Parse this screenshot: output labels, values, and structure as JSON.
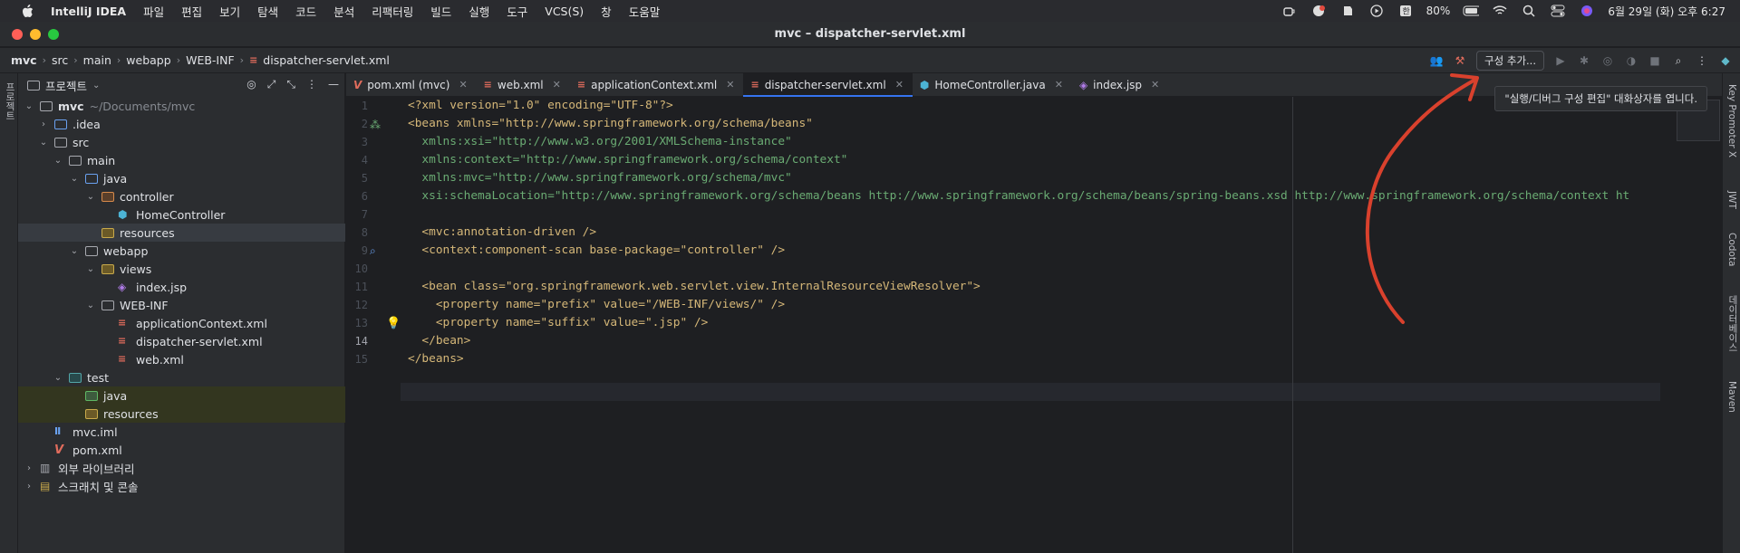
{
  "menubar": {
    "app": "IntelliJ IDEA",
    "items": [
      "파일",
      "편집",
      "보기",
      "탐색",
      "코드",
      "분석",
      "리팩터링",
      "빌드",
      "실행",
      "도구",
      "VCS(S)",
      "창",
      "도움말"
    ],
    "battery": "80%",
    "datetime": "6월 29일 (화) 오후 6:27"
  },
  "window": {
    "title": "mvc – dispatcher-servlet.xml"
  },
  "breadcrumbs": [
    "mvc",
    "src",
    "main",
    "webapp",
    "WEB-INF",
    "dispatcher-servlet.xml"
  ],
  "toolbar": {
    "run_config": "구성 추가..."
  },
  "tooltip": "\"실행/디버그 구성 편집\" 대화상자를 엽니다.",
  "project": {
    "title": "프로젝트",
    "root_label": "mvc",
    "root_path": "~/Documents/mvc",
    "tree": [
      {
        "label": ".idea"
      },
      {
        "label": "src"
      },
      {
        "label": "main"
      },
      {
        "label": "java"
      },
      {
        "label": "controller"
      },
      {
        "label": "HomeController"
      },
      {
        "label": "resources"
      },
      {
        "label": "webapp"
      },
      {
        "label": "views"
      },
      {
        "label": "index.jsp"
      },
      {
        "label": "WEB-INF"
      },
      {
        "label": "applicationContext.xml"
      },
      {
        "label": "dispatcher-servlet.xml"
      },
      {
        "label": "web.xml"
      },
      {
        "label": "test"
      },
      {
        "label": "java"
      },
      {
        "label": "resources"
      },
      {
        "label": "mvc.iml"
      },
      {
        "label": "pom.xml"
      },
      {
        "label": "외부 라이브러리"
      },
      {
        "label": "스크래치 및 콘솔"
      }
    ]
  },
  "tabs": [
    "pom.xml (mvc)",
    "web.xml",
    "applicationContext.xml",
    "dispatcher-servlet.xml",
    "HomeController.java",
    "index.jsp"
  ],
  "right_strip": [
    "Key Promoter X",
    "JWT",
    "Codota",
    "데이터베이스",
    "Maven"
  ],
  "left_strip": [
    "프로젝트"
  ],
  "editor": {
    "line_numbers": [
      "1",
      "2",
      "3",
      "4",
      "5",
      "6",
      "7",
      "8",
      "9",
      "10",
      "11",
      "12",
      "13",
      "14",
      "15"
    ],
    "lines": [
      "<?xml version=\"1.0\" encoding=\"UTF-8\"?>",
      "<beans xmlns=\"http://www.springframework.org/schema/beans\"",
      "  xmlns:xsi=\"http://www.w3.org/2001/XMLSchema-instance\"",
      "  xmlns:context=\"http://www.springframework.org/schema/context\"",
      "  xmlns:mvc=\"http://www.springframework.org/schema/mvc\"",
      "  xsi:schemaLocation=\"http://www.springframework.org/schema/beans http://www.springframework.org/schema/beans/spring-beans.xsd http://www.springframework.org/schema/context ht",
      "",
      "  <mvc:annotation-driven />",
      "  <context:component-scan base-package=\"controller\" />",
      "",
      "  <bean class=\"org.springframework.web.servlet.view.InternalResourceViewResolver\">",
      "    <property name=\"prefix\" value=\"/WEB-INF/views/\" />",
      "    <property name=\"suffix\" value=\".jsp\" />",
      "  </bean>",
      "</beans>"
    ]
  },
  "colors": {
    "accent": "#3574f0",
    "arrow": "#d9412d",
    "xml_tag": "#d5b778",
    "xml_value": "#6aab73"
  }
}
